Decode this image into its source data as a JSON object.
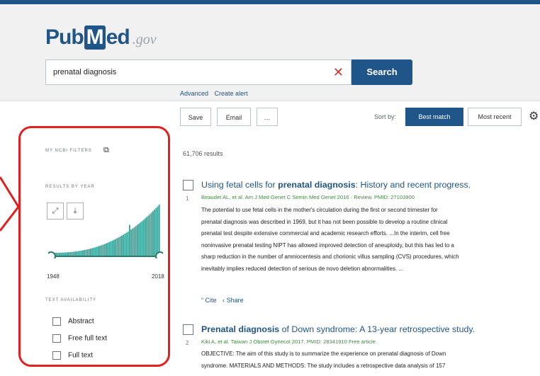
{
  "header": {
    "logo_pub": "Pub",
    "logo_m": "M",
    "logo_ed": "ed",
    "logo_gov": ".gov",
    "search_value": "prenatal diagnosis",
    "search_button": "Search",
    "advanced_link": "Advanced",
    "create_alert_link": "Create alert"
  },
  "toolbar": {
    "save": "Save",
    "email": "Email",
    "more": "…",
    "sort_by": "Sort by:",
    "best_match": "Best match",
    "most_recent": "Most recent"
  },
  "sidebar": {
    "my_ncbi_filters": "MY NCBI FILTERS",
    "results_by_year": "RESULTS BY YEAR",
    "year_start": "1948",
    "year_end": "2018",
    "text_availability": "TEXT AVAILABILITY",
    "filters": [
      "Abstract",
      "Free full text",
      "Full text"
    ]
  },
  "results": {
    "count": "61,706 results",
    "items": [
      {
        "num": "1",
        "title_pre": "Using fetal cells for ",
        "title_bold": "prenatal diagnosis",
        "title_post": ": History and recent progress.",
        "cite": "Beaudet AL, et al. Am J Med Genet C Semin Med Genet 2016 · Review. PMID: 27103900",
        "snippet_lines": [
          "The potential to use fetal cells in the mother's circulation during the first or second trimester for",
          "prenatal diagnosis was described in 1969, but it has not been possible to develop a routine clinical",
          "prenatal test despite extensive commercial and academic research efforts. ...In the interim, cell free",
          "noninvasive prenatal testing NIPT has allowed improved detection of aneuploidy, but this has led to a",
          "sharp reduction in the number of amniocentesis and chorionic villus sampling (CVS) procedures, which",
          "inevitably implies reduced detection of serious de novo deletion abnormalities. ..."
        ],
        "cite_action": "Cite",
        "share_action": "Share"
      },
      {
        "num": "2",
        "title_bold": "Prenatal diagnosis",
        "title_post": " of Down syndrome: A 13-year retrospective study.",
        "cite": "Kiki A, et al. Taiwan J Obstet Gynecol 2017. PMID: 28341910 Free article.",
        "snippet_lines": [
          "OBJECTIVE: The aim of this study is to summarize the experience on prenatal diagnosis of Down",
          "syndrome. MATERIALS AND METHODS: The study includes a retrospective data analysis of 157"
        ]
      }
    ]
  },
  "colors": {
    "brand": "#20558a",
    "highlight_outline": "#e0211f",
    "histogram_fill": "#3aa59a"
  },
  "icons": [
    "clear-icon",
    "gear-icon",
    "external-link-icon",
    "expand-icon",
    "download-icon",
    "quote-icon",
    "share-icon"
  ]
}
